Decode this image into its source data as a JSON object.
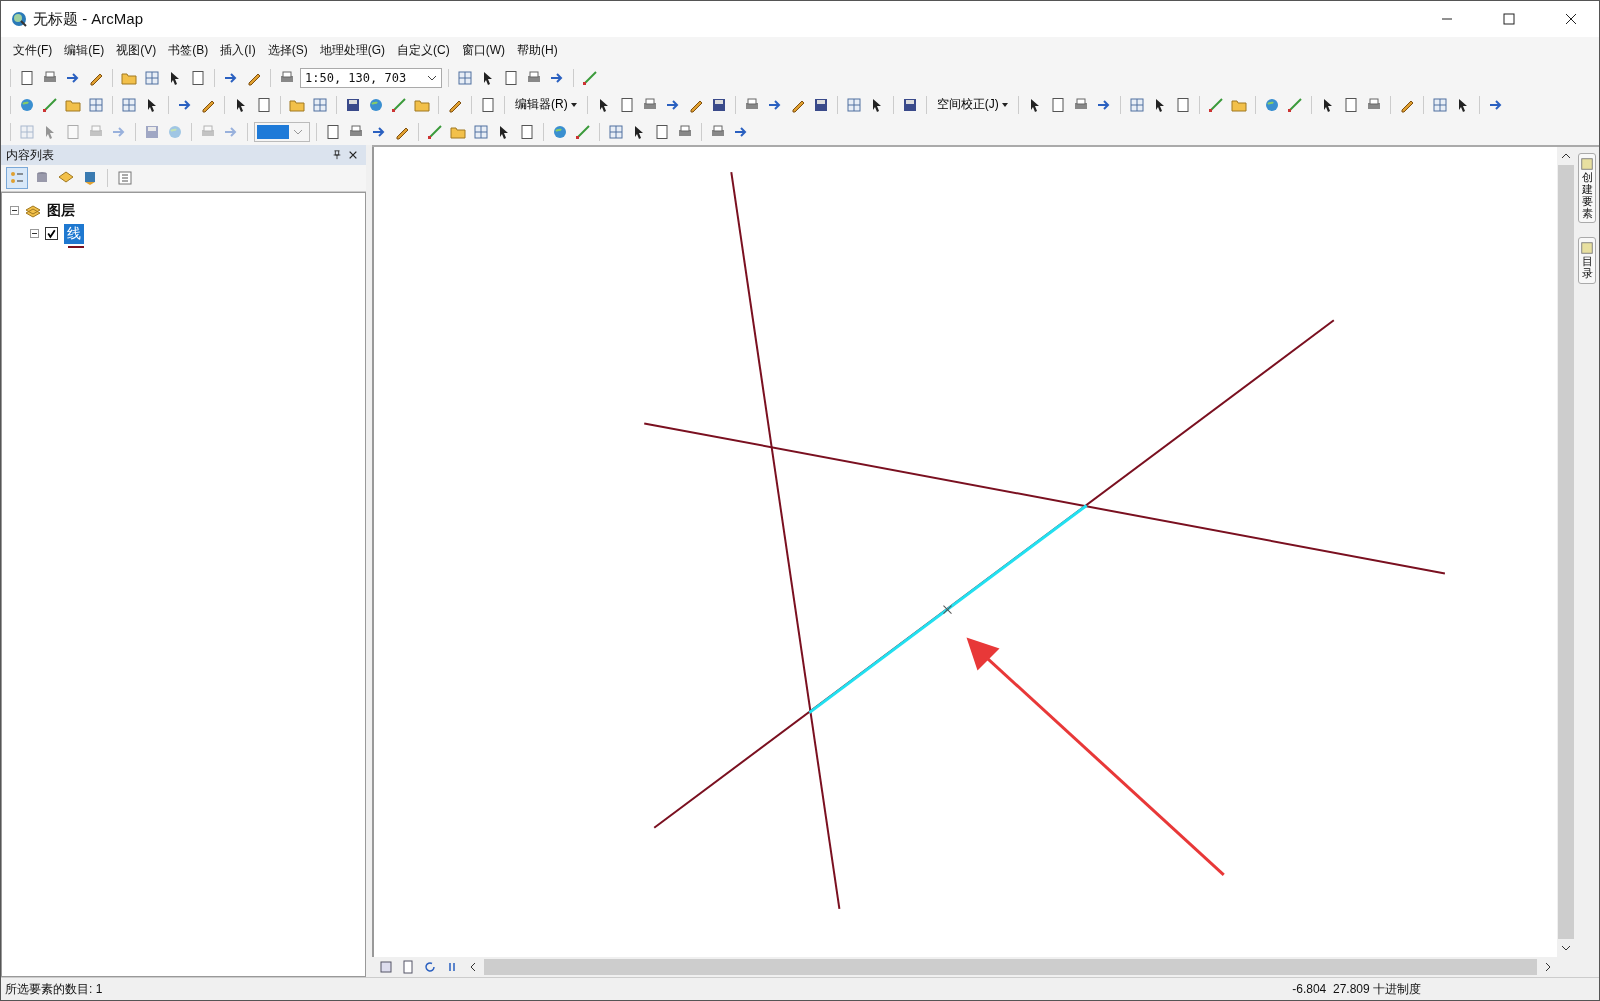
{
  "window": {
    "title": "无标题 - ArcMap"
  },
  "menu": [
    "文件(F)",
    "编辑(E)",
    "视图(V)",
    "书签(B)",
    "插入(I)",
    "选择(S)",
    "地理处理(G)",
    "自定义(C)",
    "窗口(W)",
    "帮助(H)"
  ],
  "toolbar": {
    "scale": "1:50, 130, 703",
    "editor_menu": "编辑器(R)",
    "spatial_adjustment_menu": "空间校正(J)"
  },
  "toc": {
    "title": "内容列表",
    "tree": [
      {
        "label": "图层",
        "expanded": true,
        "children": [
          {
            "label": "线",
            "checked": true,
            "selected": true,
            "expanded": true
          }
        ]
      }
    ]
  },
  "side_tabs": [
    "创建要素",
    "目录"
  ],
  "status_bar": {
    "message": "所选要素的数目: 1",
    "coordinates": "-6.804  27.809 十进制度"
  }
}
